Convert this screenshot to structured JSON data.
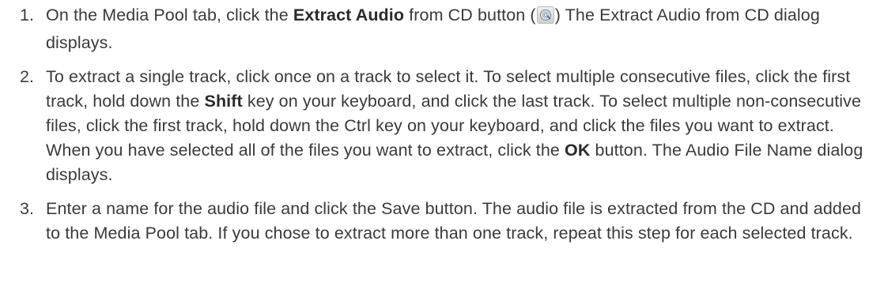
{
  "steps": [
    {
      "number": "1.",
      "t1": "On the Media Pool tab, click the ",
      "b1": "Extract Audio",
      "t2": " from CD button  (",
      "t3": ")  The Extract Audio from CD dialog displays.",
      "icon": "extract-audio-cd-icon"
    },
    {
      "number": "2.",
      "t1": "To extract a single track, click once on a track to select it. To select multiple consecutive files, click the first track, hold down the ",
      "b1": "Shift",
      "t2": " key on your keyboard, and click the last track. To select multiple non-consecutive files, click the first track, hold down the Ctrl key on your keyboard, and click the files you want to extract. When you have selected all of the files you want to extract, click the ",
      "b2": "OK",
      "t3": " button. The Audio File Name dialog displays."
    },
    {
      "number": "3.",
      "t1": "Enter a name for the audio file and click the Save button. The audio file is extracted from the CD and added to the Media Pool tab. If you chose to extract more than one track, repeat this step for each selected track."
    }
  ],
  "colors": {
    "text": "#3a3a3a",
    "background": "#ffffff"
  }
}
